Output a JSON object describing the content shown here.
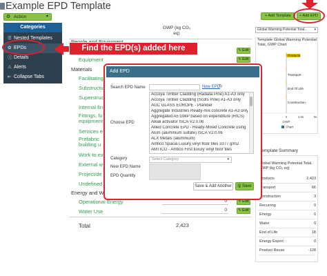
{
  "header": {
    "title": "Example EPD Template",
    "action_label": "Action",
    "add_template_label": "+ Add Template",
    "add_epd_label": "+ Add EPD"
  },
  "sidebar": {
    "categories_label": "Categories",
    "items": [
      "Nested Templates",
      "EPDs",
      "Details",
      "Alerts",
      "Collapse Tabs"
    ]
  },
  "callout": {
    "text": "Find the EPD(s) added here"
  },
  "table": {
    "gwp_header": "GWP (kg CO₂ eq)",
    "sections": {
      "people": "People and Equipment",
      "materials": "Materials",
      "energy": "Energy and Water"
    },
    "people_rows": [
      "Equipment"
    ],
    "material_rows": [
      "Facilitating",
      "Substructure",
      "Superstructure",
      "Internal fin",
      "Fittings, fu equipment",
      "Services e",
      "Prefabric building u",
      "Work to ex",
      "External w",
      "Project/de",
      "Undefined"
    ],
    "energy_rows": [
      {
        "label": "Operational Energy",
        "value": "0"
      },
      {
        "label": "Water Use",
        "value": "0"
      }
    ],
    "undefined_value": "0",
    "total_label": "Total",
    "total_value": "2,423",
    "edit_label": "Edit"
  },
  "right_panel": {
    "select_value": "Global Warming Potential Total...",
    "chart_title": "Template Global Warming Potential Total, GWP Chart",
    "summary_title": "Template Summary",
    "summary_head": "Global Warming Potential Total, GWP (kg CO₂ eq)",
    "summary": [
      {
        "label": "Products",
        "value": "2,423"
      },
      {
        "label": "Transport",
        "value": "66"
      },
      {
        "label": "Construction",
        "value": "3"
      },
      {
        "label": "Recurring",
        "value": "0"
      },
      {
        "label": "Energy",
        "value": "0"
      },
      {
        "label": "Water",
        "value": "0"
      },
      {
        "label": "End of Life",
        "value": "18"
      },
      {
        "label": "Energy Export",
        "value": "0"
      },
      {
        "label": "Product Reuse",
        "value": "-128"
      }
    ]
  },
  "chart_data": {
    "type": "bar",
    "orientation": "horizontal",
    "categories": [
      "Products",
      "Transport",
      "End Of Life",
      "Construction"
    ],
    "values": [
      2423,
      66,
      18,
      3
    ],
    "xlim": [
      -5000,
      5000
    ],
    "x_ticks": [
      "-5k",
      "0",
      "2.5k",
      "5k"
    ],
    "xlabel": "GWP",
    "legend": [
      "Chart"
    ],
    "legend_position": "bottom"
  },
  "modal": {
    "title": "Add EPD",
    "search_label": "Search EPD Name",
    "new_epd_link": "New EPD",
    "choose_label": "Choose EPD",
    "epd_options": [
      "Accoya Timber Cladding (Radiata Pine) A1-A3 only",
      "Accoya Timber Cladding (Scots Pine) A1-A3 only",
      "AGC GLASS EUROPE - Planibel",
      "Aggregate Industries Ready-mix concrete A1-A3 only",
      "Aggregated A5 GWP based on expenditure (RICS)",
      "Alkali activator ISCA V2.0.06",
      "Allied Concrete EPD - Ready-Mixed Concrete using",
      "Alum (aluminium sulfate) ISCA V2.0.06",
      "ALX Metals (aluminium)",
      "Amtico Spacia Luxury vinyl floor tiles 3377 g/m2",
      "AMTICO - Amtico First luxury vinyl floor tiles"
    ],
    "category_label": "Category",
    "category_placeholder": "Select Category",
    "new_name_label": "New EPD Name",
    "quantity_label": "EPD Quantity",
    "save_add_label": "Save & Add Another",
    "save_label": "Save"
  },
  "colors": {
    "green": "#8bc34a",
    "sidebar": "#2e3f4e",
    "sidebar_active": "#1f5f98",
    "modal_header": "#3b6e8a",
    "annotation_red": "#e0202a",
    "row_text": "#2e9e4e"
  }
}
